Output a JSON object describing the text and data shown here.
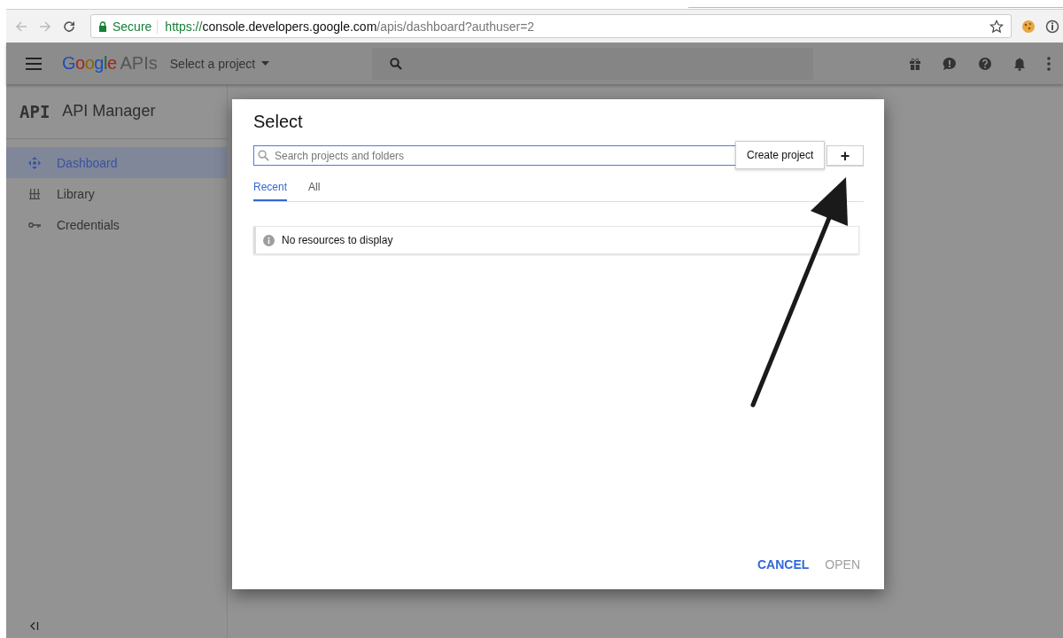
{
  "browser": {
    "secure_label": "Secure",
    "url": {
      "scheme": "https://",
      "host": "console.developers.google.com",
      "path": "/apis/dashboard?authuser=2"
    }
  },
  "header": {
    "logo": "Google",
    "product": "APIs",
    "project_picker": "Select a project"
  },
  "sidebar": {
    "logo": "API",
    "title": "API Manager",
    "items": [
      {
        "label": "Dashboard",
        "kind": "dashboard",
        "selected": true
      },
      {
        "label": "Library",
        "kind": "library",
        "selected": false
      },
      {
        "label": "Credentials",
        "kind": "credentials",
        "selected": false
      }
    ]
  },
  "dialog": {
    "title": "Select",
    "search": {
      "placeholder": "Search projects and folders"
    },
    "tooltip": "Create project",
    "add_button": "+",
    "tabs": [
      {
        "label": "Recent",
        "selected": true
      },
      {
        "label": "All",
        "selected": false
      }
    ],
    "message": "No resources to display",
    "buttons": [
      {
        "label": "CANCEL",
        "disabled": false
      },
      {
        "label": "OPEN",
        "disabled": true
      }
    ]
  }
}
